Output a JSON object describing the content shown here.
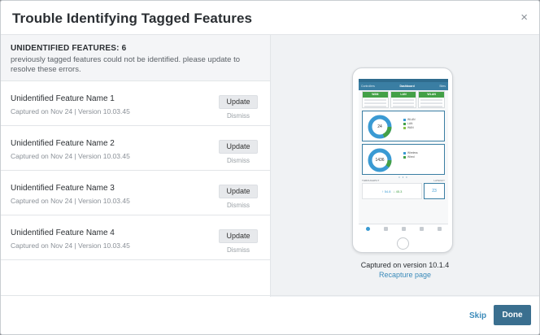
{
  "modal": {
    "title": "Trouble Identifying Tagged Features",
    "close_glyph": "×"
  },
  "summary": {
    "count_label": "UNIDENTIFIED FEATURES: 6",
    "description": "previously tagged features could not be identified. please update to resolve these errors."
  },
  "features": [
    {
      "name": "Unidentified Feature Name 1",
      "meta": "Captured on Nov 24 | Version 10.03.45",
      "update_label": "Update",
      "dismiss_label": "Dismiss"
    },
    {
      "name": "Unidentified Feature Name 2",
      "meta": "Captured on Nov 24 | Version 10.03.45",
      "update_label": "Update",
      "dismiss_label": "Dismiss"
    },
    {
      "name": "Unidentified Feature Name 3",
      "meta": "Captured on Nov 24 | Version 10.03.45",
      "update_label": "Update",
      "dismiss_label": "Dismiss"
    },
    {
      "name": "Unidentified Feature Name 4",
      "meta": "Captured on Nov 24 | Version 10.03.45",
      "update_label": "Update",
      "dismiss_label": "Dismiss"
    }
  ],
  "preview": {
    "caption": "Captured on version 10.1.4",
    "recapture_label": "Recapture page",
    "phone": {
      "nav_left": "Controllers",
      "nav_title": "Dashboard",
      "nav_right": "Sites",
      "tiles": [
        "WAN",
        "LAN",
        "WLAN"
      ],
      "donut1_value": "24",
      "donut2_value": "1436",
      "legend1": [
        "WLAN",
        "LAN",
        "WAN"
      ],
      "legend2": [
        "Wireless",
        "Wired"
      ],
      "throughput_label": "THROUGHPUT",
      "latency_label": "LATENCY",
      "throughput_down": "↑ 54.8",
      "throughput_up": "↓ 45.3",
      "latency_value": "23"
    }
  },
  "footer": {
    "skip_label": "Skip",
    "done_label": "Done"
  },
  "colors": {
    "primary": "#3a6f8f",
    "link": "#3b8bba",
    "phone_accent": "#3a7ea3",
    "green": "#43a047"
  }
}
